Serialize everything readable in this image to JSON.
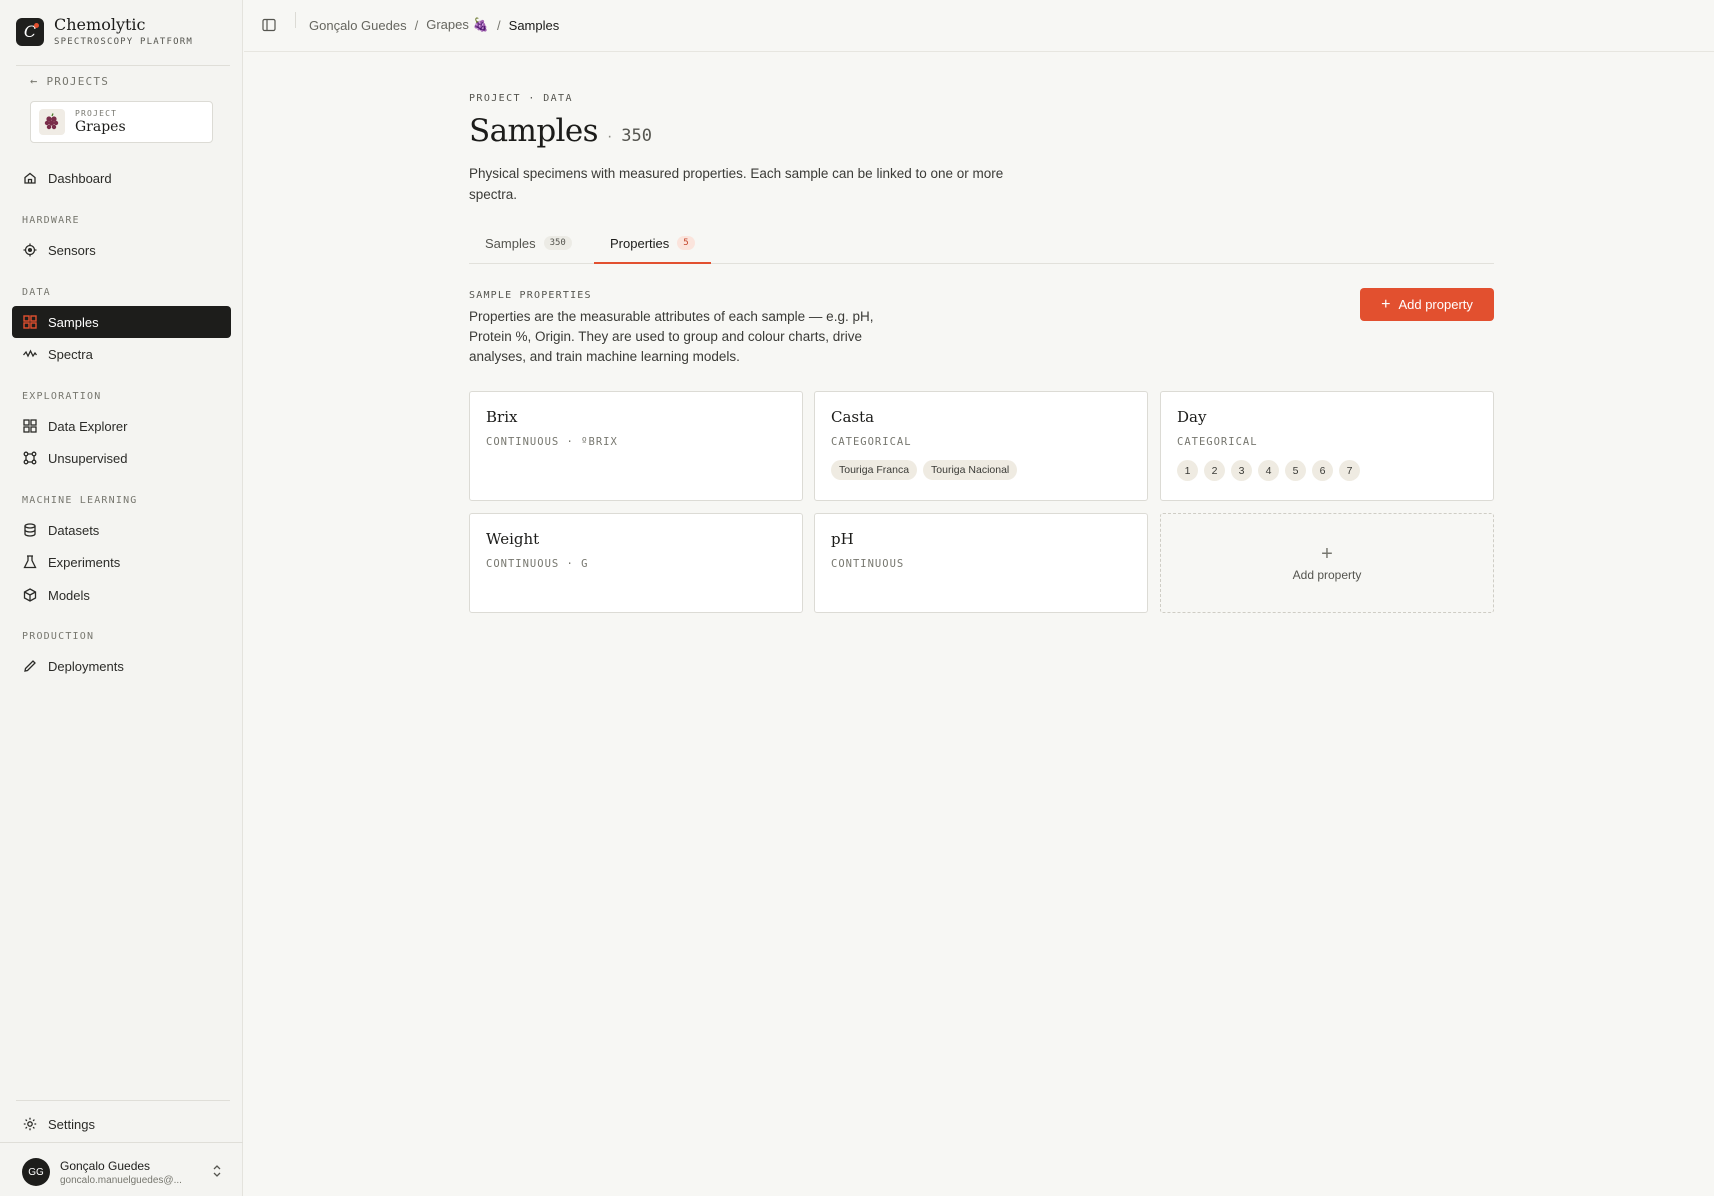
{
  "brand": {
    "name": "Chemolytic",
    "subtitle": "SPECTROSCOPY PLATFORM",
    "logo_letter": "C"
  },
  "sidebar": {
    "back_label": "PROJECTS",
    "project": {
      "label": "PROJECT",
      "name": "Grapes",
      "icon": "grape-icon"
    },
    "dashboard": "Dashboard",
    "sections": {
      "hardware": "HARDWARE",
      "data": "DATA",
      "exploration": "EXPLORATION",
      "machine_learning": "MACHINE LEARNING",
      "production": "PRODUCTION"
    },
    "items": {
      "sensors": "Sensors",
      "samples": "Samples",
      "spectra": "Spectra",
      "data_explorer": "Data Explorer",
      "unsupervised": "Unsupervised",
      "datasets": "Datasets",
      "experiments": "Experiments",
      "models": "Models",
      "deployments": "Deployments"
    },
    "settings": "Settings",
    "user": {
      "initials": "GG",
      "name": "Gonçalo Guedes",
      "email": "goncalo.manuelguedes@..."
    }
  },
  "breadcrumb": {
    "user": "Gonçalo Guedes",
    "project": "Grapes",
    "current": "Samples"
  },
  "page": {
    "eyebrow": "PROJECT · DATA",
    "title": "Samples",
    "title_sep": "·",
    "count": "350",
    "description": "Physical specimens with measured properties. Each sample can be linked to one or more spectra."
  },
  "tabs": [
    {
      "label": "Samples",
      "badge": "350"
    },
    {
      "label": "Properties",
      "badge": "5"
    }
  ],
  "properties_section": {
    "label": "SAMPLE PROPERTIES",
    "description": "Properties are the measurable attributes of each sample — e.g. pH, Protein %, Origin. They are used to group and colour charts, drive analyses, and train machine learning models.",
    "add_button": "Add property",
    "add_card_label": "Add property"
  },
  "properties": [
    {
      "name": "Brix",
      "type": "CONTINUOUS · ºBRIX",
      "values": []
    },
    {
      "name": "Casta",
      "type": "CATEGORICAL",
      "values": [
        "Touriga Franca",
        "Touriga Nacional"
      ]
    },
    {
      "name": "Day",
      "type": "CATEGORICAL",
      "values": [
        "1",
        "2",
        "3",
        "4",
        "5",
        "6",
        "7"
      ]
    },
    {
      "name": "Weight",
      "type": "CONTINUOUS · G",
      "values": []
    },
    {
      "name": "pH",
      "type": "CONTINUOUS",
      "values": []
    }
  ],
  "colors": {
    "accent": "#e2502f",
    "active_nav": "#1d1d1b",
    "background": "#f7f7f4"
  }
}
